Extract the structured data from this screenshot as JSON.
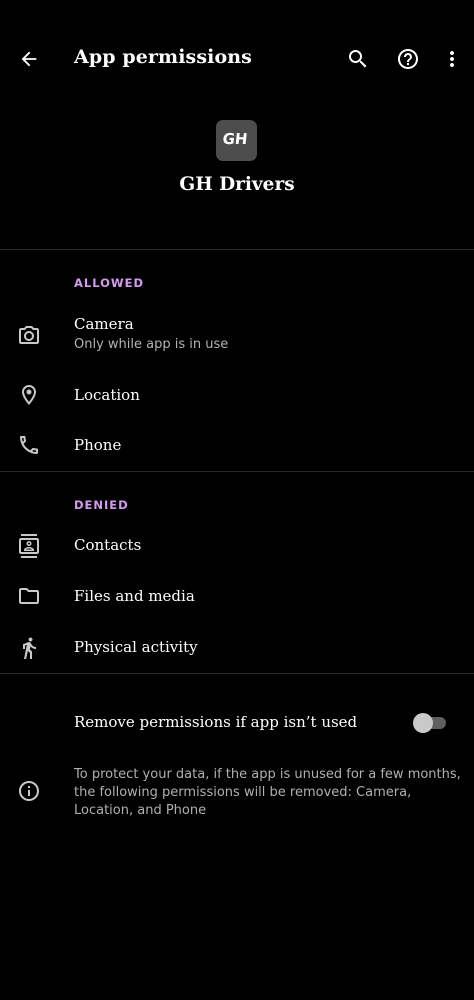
{
  "toolbar": {
    "title": "App permissions",
    "back_icon": "arrow-back-icon",
    "search_icon": "search-icon",
    "help_icon": "help-icon",
    "more_icon": "more-vert-icon"
  },
  "app": {
    "name": "GH Drivers",
    "logo_text": "GH"
  },
  "sections": {
    "allowed": {
      "label": "ALLOWED",
      "items": [
        {
          "title": "Camera",
          "subtitle": "Only while app is in use",
          "icon": "camera-icon"
        },
        {
          "title": "Location",
          "icon": "location-icon"
        },
        {
          "title": "Phone",
          "icon": "phone-icon"
        }
      ]
    },
    "denied": {
      "label": "DENIED",
      "items": [
        {
          "title": "Contacts",
          "icon": "contacts-icon"
        },
        {
          "title": "Files and media",
          "icon": "folder-icon"
        },
        {
          "title": "Physical activity",
          "icon": "walking-icon"
        }
      ]
    }
  },
  "auto_revoke": {
    "label": "Remove permissions if app isn’t used",
    "enabled": false
  },
  "info": {
    "text": "To protect your data, if the app is unused for a few months, the following permissions will be removed: Camera, Location, and Phone",
    "icon": "info-icon"
  },
  "colors": {
    "background": "#000000",
    "accent": "#d59bf0",
    "secondary_text": "#b3b3b3"
  }
}
